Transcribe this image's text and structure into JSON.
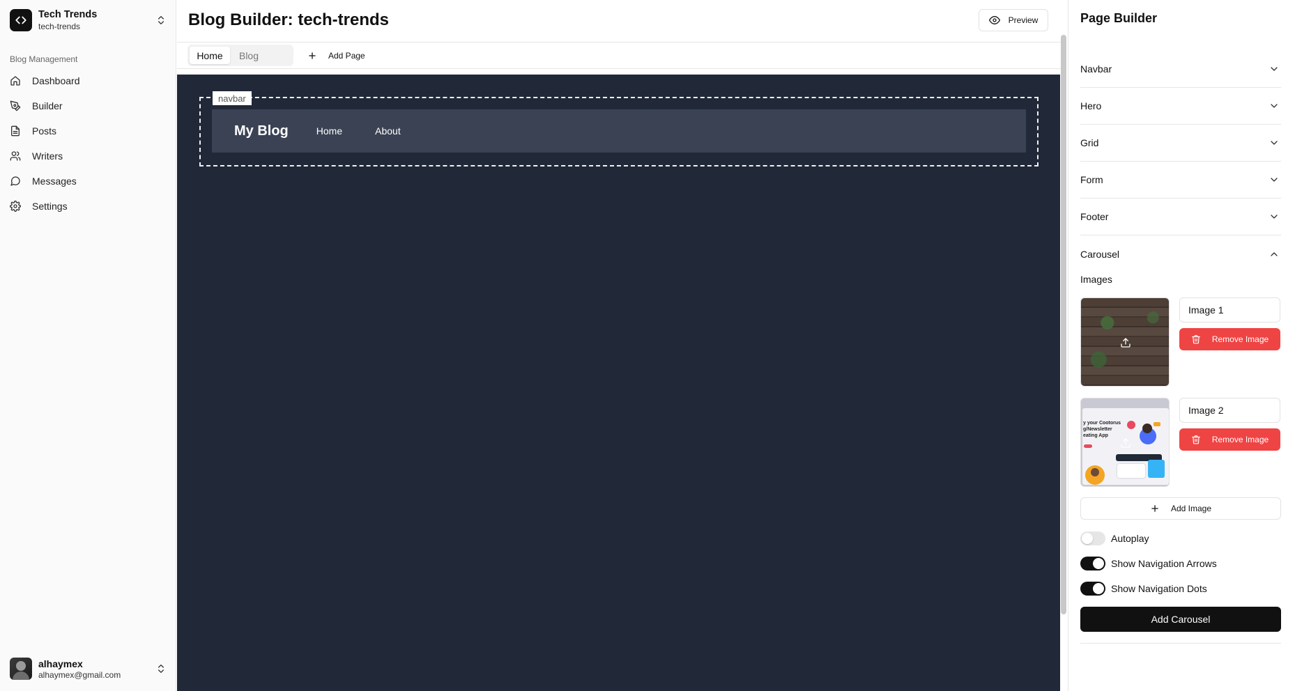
{
  "workspace": {
    "name": "Tech Trends",
    "slug": "tech-trends"
  },
  "sidebar": {
    "group_label": "Blog Management",
    "items": [
      {
        "label": "Dashboard",
        "icon": "home-icon"
      },
      {
        "label": "Builder",
        "icon": "pen-tool-icon"
      },
      {
        "label": "Posts",
        "icon": "file-text-icon"
      },
      {
        "label": "Writers",
        "icon": "users-icon"
      },
      {
        "label": "Messages",
        "icon": "message-circle-icon"
      },
      {
        "label": "Settings",
        "icon": "gear-icon"
      }
    ]
  },
  "user": {
    "name": "alhaymex",
    "email": "alhaymex@gmail.com"
  },
  "header": {
    "title": "Blog Builder: tech-trends",
    "preview_label": "Preview"
  },
  "page_tabs": {
    "tabs": [
      "Home",
      "Blog"
    ],
    "active": "Home",
    "add_page_label": "Add Page"
  },
  "canvas": {
    "navbar_tag": "navbar",
    "blog_navbar": {
      "brand": "My Blog",
      "links": [
        "Home",
        "About"
      ]
    }
  },
  "panel": {
    "title": "Page Builder",
    "sections": [
      "Navbar",
      "Hero",
      "Grid",
      "Form",
      "Footer",
      "Carousel"
    ],
    "open_section": "Carousel",
    "carousel": {
      "images_label": "Images",
      "images": [
        {
          "name": "Image 1",
          "remove_label": "Remove Image"
        },
        {
          "name": "Image 2",
          "remove_label": "Remove Image"
        }
      ],
      "image2_thumb_text": "y your Cootorus\ng/Newsletter\neating App",
      "add_image_label": "Add Image",
      "toggles": [
        {
          "label": "Autoplay",
          "on": false
        },
        {
          "label": "Show Navigation Arrows",
          "on": true
        },
        {
          "label": "Show Navigation Dots",
          "on": true
        }
      ],
      "submit_label": "Add Carousel"
    }
  },
  "colors": {
    "canvas_bg": "#212838",
    "blog_navbar_bg": "#3a4254",
    "danger": "#ef4444",
    "primary": "#111111"
  }
}
